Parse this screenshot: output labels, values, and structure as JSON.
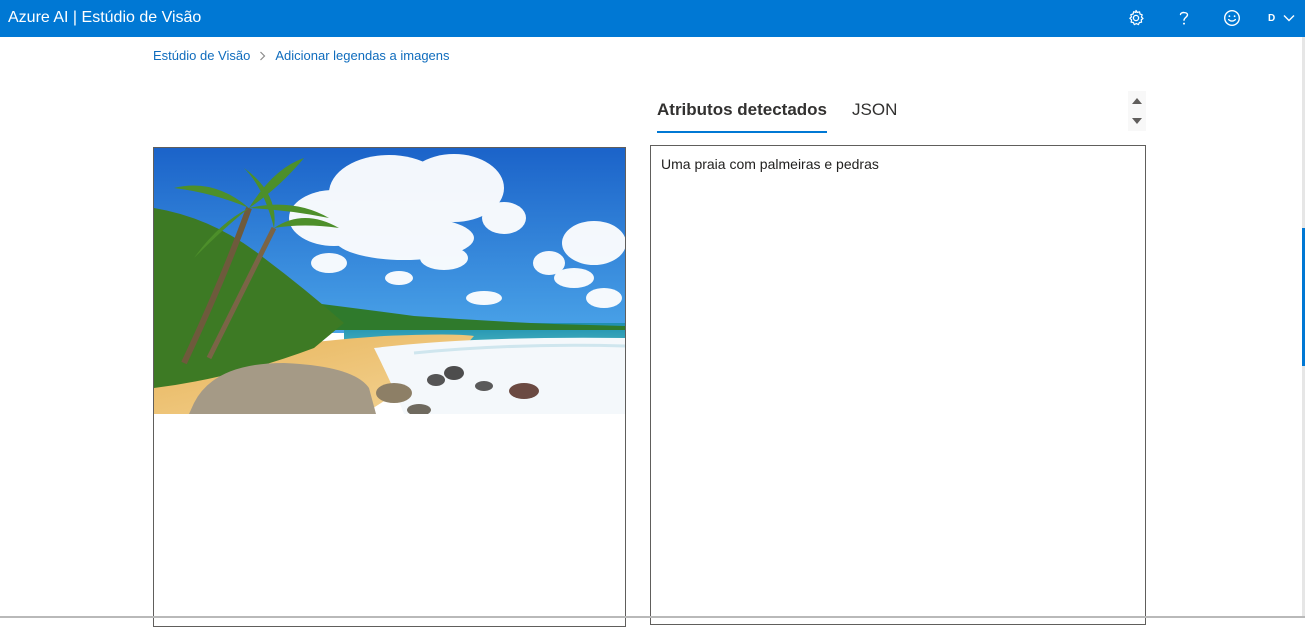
{
  "header": {
    "title": "Azure AI | Estúdio de Visão",
    "icons": [
      "gear-icon",
      "help-icon",
      "feedback-smiley-icon"
    ],
    "avatar_letter": "D",
    "colors": {
      "bar": "#0078d4",
      "text": "#ffffff"
    }
  },
  "breadcrumb": {
    "items": [
      "Estúdio de Visão",
      "Adicionar legendas a imagens"
    ]
  },
  "tabs": {
    "items": [
      {
        "label": "Atributos detectados",
        "active": true
      },
      {
        "label": "JSON",
        "active": false
      }
    ],
    "accent": "#0078d4"
  },
  "result": {
    "caption": "Uma praia com palmeiras e pedras"
  },
  "image": {
    "subject": "beach-photo"
  }
}
